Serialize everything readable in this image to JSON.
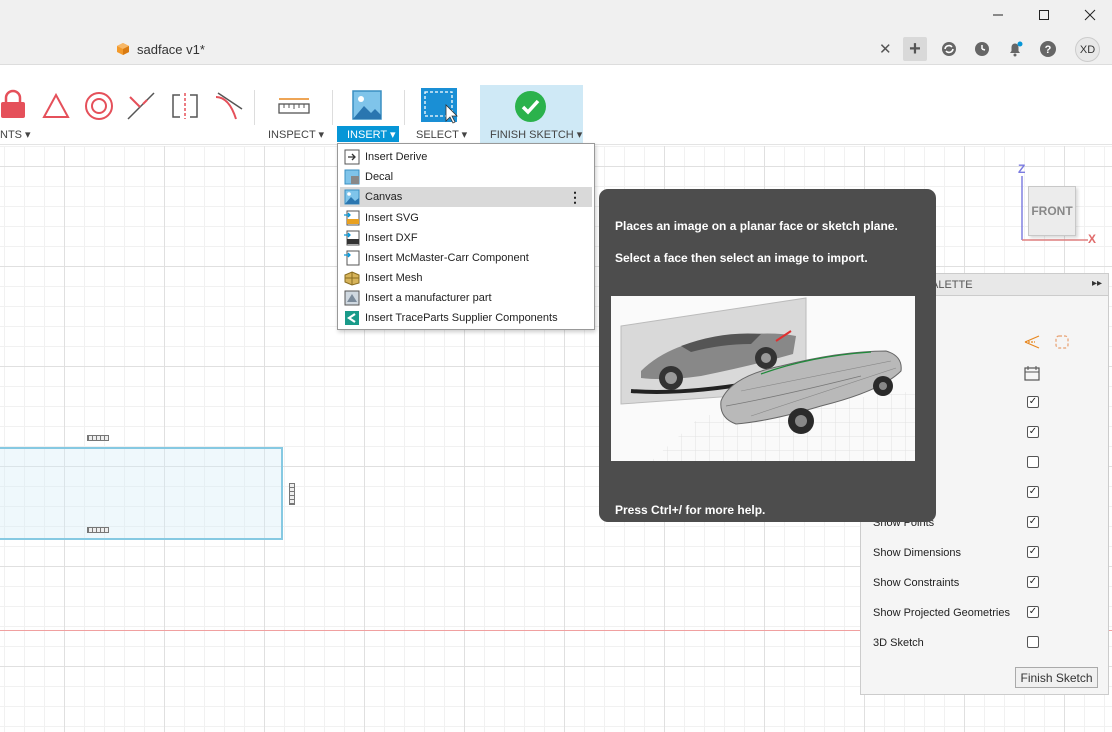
{
  "document": {
    "title": "sadface v1*"
  },
  "ribbon": {
    "constraints_label": "NTS",
    "inspect_label": "INSPECT",
    "insert_label": "INSERT",
    "select_label": "SELECT",
    "finish_sketch_label": "FINISH SKETCH"
  },
  "insert_menu": {
    "items": [
      {
        "label": "Insert Derive",
        "icon": "derive-icon"
      },
      {
        "label": "Decal",
        "icon": "decal-icon"
      },
      {
        "label": "Canvas",
        "icon": "canvas-icon",
        "highlighted": true
      },
      {
        "label": "Insert SVG",
        "icon": "svg-icon"
      },
      {
        "label": "Insert DXF",
        "icon": "dxf-icon"
      },
      {
        "label": "Insert McMaster-Carr Component",
        "icon": "mcmaster-icon"
      },
      {
        "label": "Insert Mesh",
        "icon": "mesh-icon"
      },
      {
        "label": "Insert a manufacturer part",
        "icon": "manufacturer-part-icon"
      },
      {
        "label": "Insert TraceParts Supplier Components",
        "icon": "traceparts-icon"
      }
    ]
  },
  "tooltip": {
    "line1": "Places an image on a planar face or sketch plane.",
    "line2": "Select a face then select an image to import.",
    "help": "Press Ctrl+/ for more help."
  },
  "viewcube": {
    "face": "FRONT",
    "axis_z": "Z",
    "axis_x": "X"
  },
  "palette": {
    "title": "ALETTE",
    "rows": [
      {
        "label": "Show Points",
        "checked": true
      },
      {
        "label": "Show Dimensions",
        "checked": true
      },
      {
        "label": "Show Constraints",
        "checked": true
      },
      {
        "label": "Show Projected Geometries",
        "checked": true
      },
      {
        "label": "3D Sketch",
        "checked": false
      }
    ],
    "upper_checks": [
      true,
      true,
      false,
      true
    ],
    "finish_button": "Finish Sketch"
  },
  "user": {
    "initials": "XD"
  },
  "colors": {
    "accent": "#0696d7",
    "finish_bg": "#cfe9f6",
    "tooltip_bg": "#4d4d4d",
    "check_green": "#2bb24c"
  }
}
